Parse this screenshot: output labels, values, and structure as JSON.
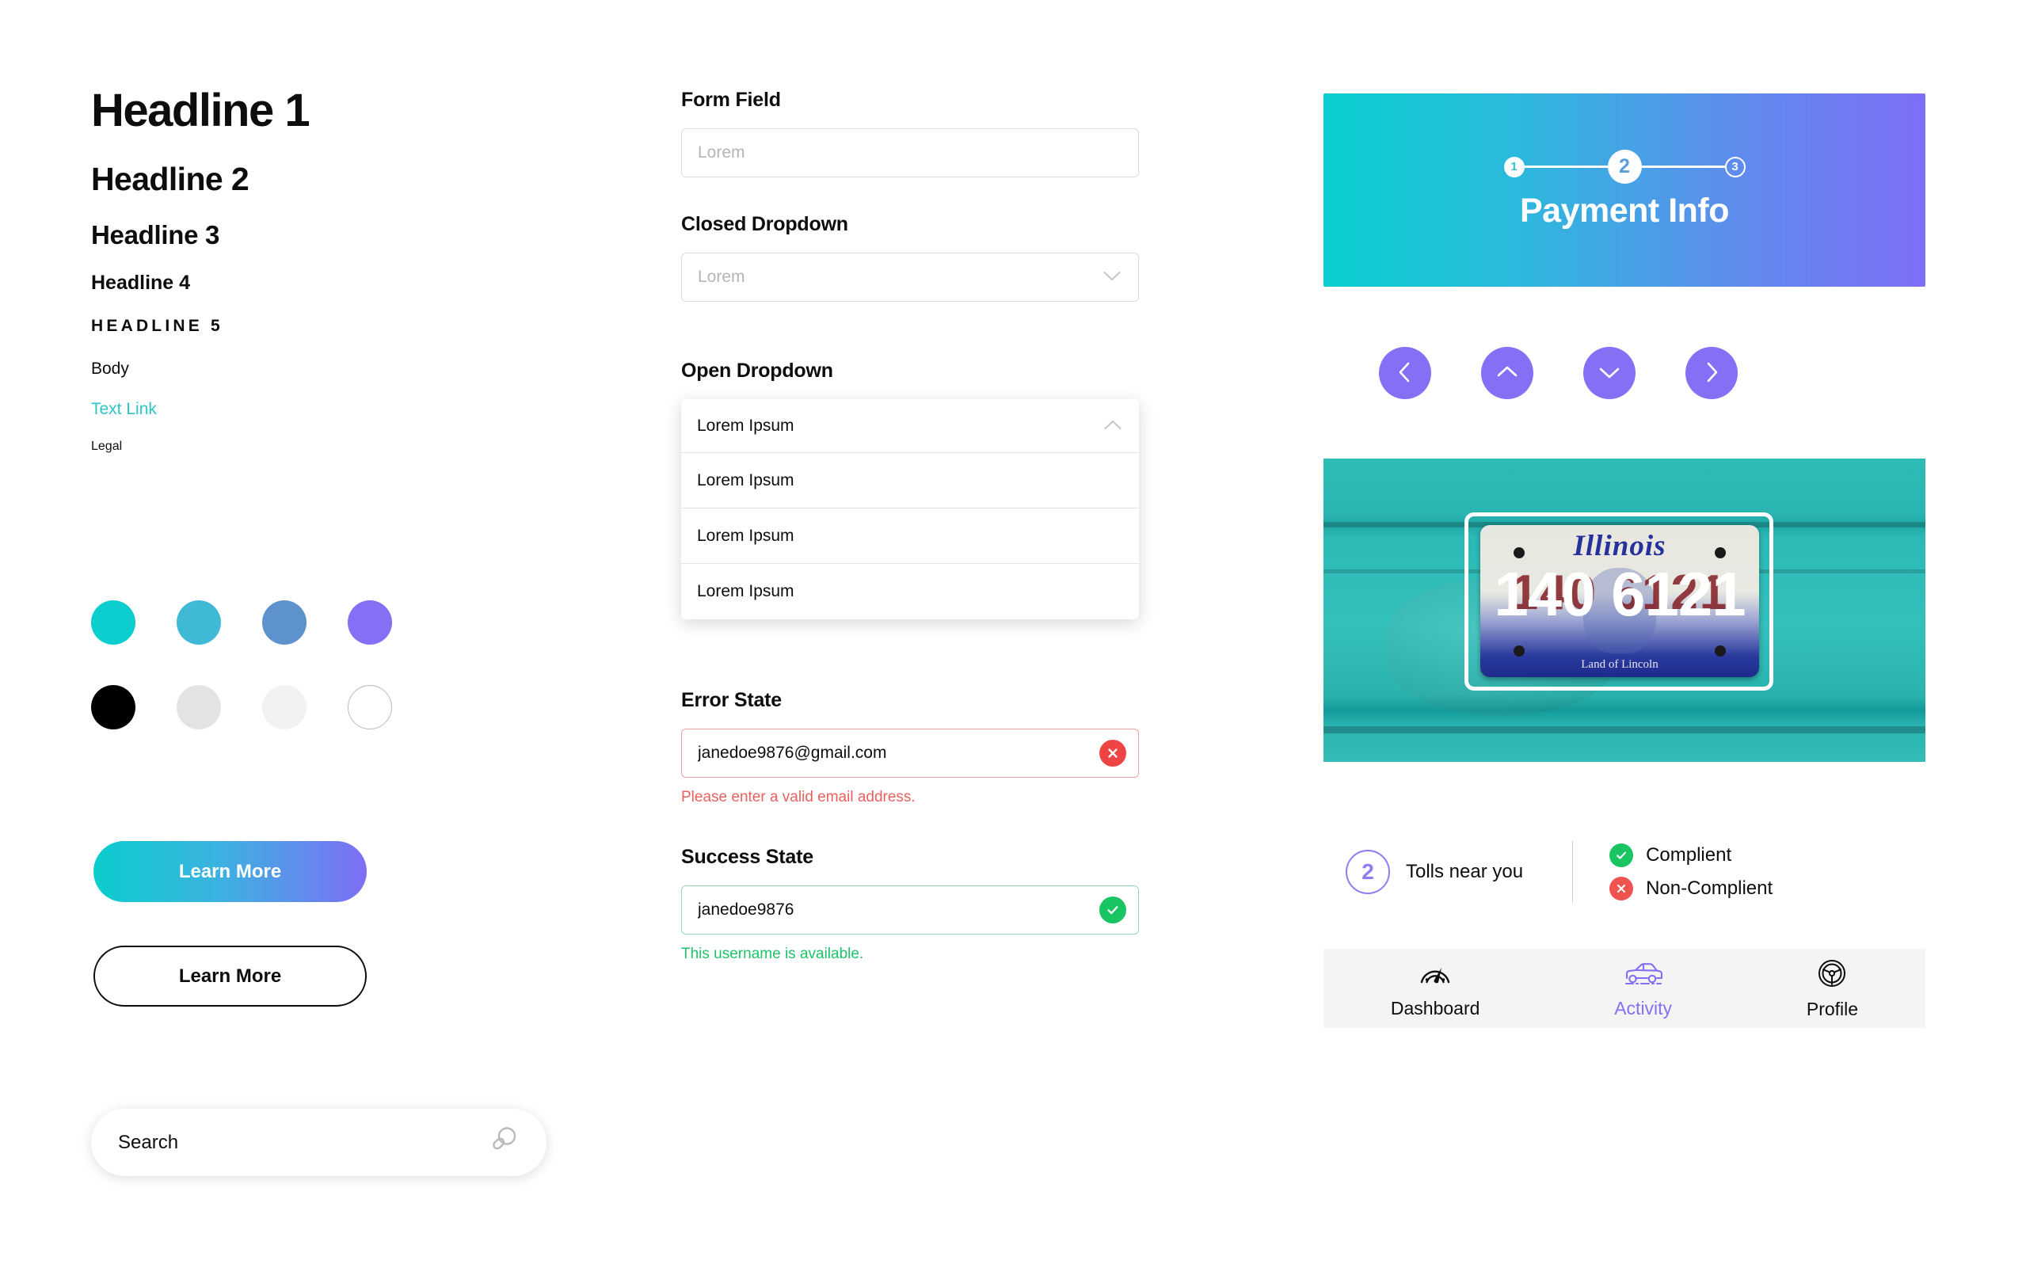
{
  "typography": {
    "headline1": "Headline 1",
    "headline2": "Headline 2",
    "headline3": "Headline 3",
    "headline4": "Headline 4",
    "headline5": "HEADLINE 5",
    "body": "Body",
    "text_link": "Text Link",
    "legal": "Legal"
  },
  "colors": {
    "teal": "#0ccdcd",
    "sky": "#3fb9d6",
    "blue": "#5e92cc",
    "purple": "#8370f5",
    "black": "#000000",
    "gray_dark": "#e3e3e3",
    "gray_light": "#f2f2f2",
    "white": "#ffffff",
    "link": "#2cc6c6",
    "error": "#ee4444",
    "success": "#19c463",
    "error_text": "#e8615f",
    "success_text": "#1ec36a",
    "gradient_start": "#07cfcf",
    "gradient_end": "#7d6ef5"
  },
  "swatches": {
    "row1": [
      {
        "name": "teal",
        "hex": "#0ccdcd"
      },
      {
        "name": "sky",
        "hex": "#3fb9d6"
      },
      {
        "name": "blue",
        "hex": "#5e92cc"
      },
      {
        "name": "purple",
        "hex": "#8370f5"
      }
    ],
    "row2": [
      {
        "name": "black",
        "hex": "#000000"
      },
      {
        "name": "gray-dark",
        "hex": "#e3e3e3"
      },
      {
        "name": "gray-light",
        "hex": "#f2f2f2"
      },
      {
        "name": "white",
        "hex": "#ffffff"
      }
    ]
  },
  "buttons": {
    "primary_label": "Learn More",
    "secondary_label": "Learn More"
  },
  "search": {
    "placeholder": "Search",
    "value": "",
    "icon": "search-icon"
  },
  "form": {
    "form_field": {
      "label": "Form Field",
      "placeholder": "Lorem",
      "value": ""
    },
    "closed_dropdown": {
      "label": "Closed Dropdown",
      "placeholder": "Lorem",
      "selected": "Lorem",
      "icon": "chevron-down-icon"
    },
    "open_dropdown": {
      "label": "Open Dropdown",
      "selected": "Lorem Ipsum",
      "icon": "chevron-up-icon",
      "options": [
        "Lorem Ipsum",
        "Lorem Ipsum",
        "Lorem Ipsum"
      ]
    },
    "error_state": {
      "label": "Error State",
      "value": "janedoe9876@gmail.com",
      "message": "Please enter a valid email address.",
      "icon": "error-circle-icon"
    },
    "success_state": {
      "label": "Success State",
      "value": "janedoe9876",
      "message": "This username is available.",
      "icon": "check-circle-icon"
    }
  },
  "app": {
    "payment_header": {
      "title": "Payment Info",
      "steps": [
        "1",
        "2",
        "3"
      ],
      "active_step": "2"
    },
    "nav_buttons": [
      {
        "name": "chevron-left-icon",
        "label": "previous"
      },
      {
        "name": "chevron-up-icon",
        "label": "up"
      },
      {
        "name": "chevron-down-icon",
        "label": "down"
      },
      {
        "name": "chevron-right-icon",
        "label": "next"
      }
    ],
    "plate": {
      "state": "Illinois",
      "slogan": "Land of Lincoln",
      "number": "140 6121",
      "ghost_number": "140 6121"
    },
    "tolls": {
      "count": "2",
      "label": "Tolls near you"
    },
    "legend": [
      {
        "status": "compliant",
        "label": "Complient",
        "icon": "check-circle-icon"
      },
      {
        "status": "non-compliant",
        "label": "Non-Complient",
        "icon": "error-circle-icon"
      }
    ],
    "tabbar": {
      "active": "Activity",
      "tabs": [
        {
          "label": "Dashboard",
          "icon": "speedometer-icon"
        },
        {
          "label": "Activity",
          "icon": "car-icon"
        },
        {
          "label": "Profile",
          "icon": "steering-wheel-icon"
        }
      ]
    }
  }
}
